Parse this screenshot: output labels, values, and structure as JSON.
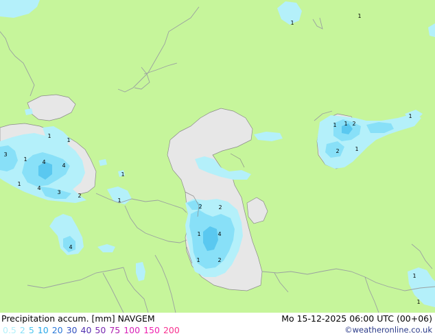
{
  "map": {
    "colors": {
      "land": "#c6f59b",
      "water": "#e7e7e7",
      "precip_light": "#b4f0fa",
      "precip_mid": "#88e0f8",
      "precip_heavy": "#5ac8f0",
      "border": "#9aa0a0",
      "coast": "#8a8a8a"
    },
    "values": {
      "v01": "1",
      "v02": "1",
      "v03": "1",
      "v04": "1",
      "v05": "3",
      "v06": "1",
      "v07": "4",
      "v08": "4",
      "v09": "1",
      "v10": "4",
      "v11": "3",
      "v12": "2",
      "v13": "1",
      "v14": "1",
      "v15": "4",
      "v16": "2",
      "v17": "2",
      "v18": "1",
      "v19": "4",
      "v20": "1",
      "v21": "2",
      "v22": "1",
      "v23": "1",
      "v24": "2",
      "v25": "2",
      "v26": "1",
      "v27": "1",
      "v28": "1",
      "v29": "1"
    }
  },
  "footer": {
    "title": "Precipitation accum. [mm] NAVGEM",
    "run": "Mo 15-12-2025 06:00 UTC (00+06)",
    "credit": "©weatheronline.co.uk"
  },
  "legend": [
    {
      "label": "0.5",
      "color": "#b4f0fa"
    },
    {
      "label": "2",
      "color": "#88e0f8"
    },
    {
      "label": "5",
      "color": "#50c8f0"
    },
    {
      "label": "10",
      "color": "#28a8e8"
    },
    {
      "label": "20",
      "color": "#2878d8"
    },
    {
      "label": "30",
      "color": "#3050c0"
    },
    {
      "label": "40",
      "color": "#5030b0"
    },
    {
      "label": "50",
      "color": "#7828b0"
    },
    {
      "label": "75",
      "color": "#b020b0"
    },
    {
      "label": "100",
      "color": "#d820b8"
    },
    {
      "label": "150",
      "color": "#f020b0"
    },
    {
      "label": "200",
      "color": "#f83090"
    }
  ]
}
